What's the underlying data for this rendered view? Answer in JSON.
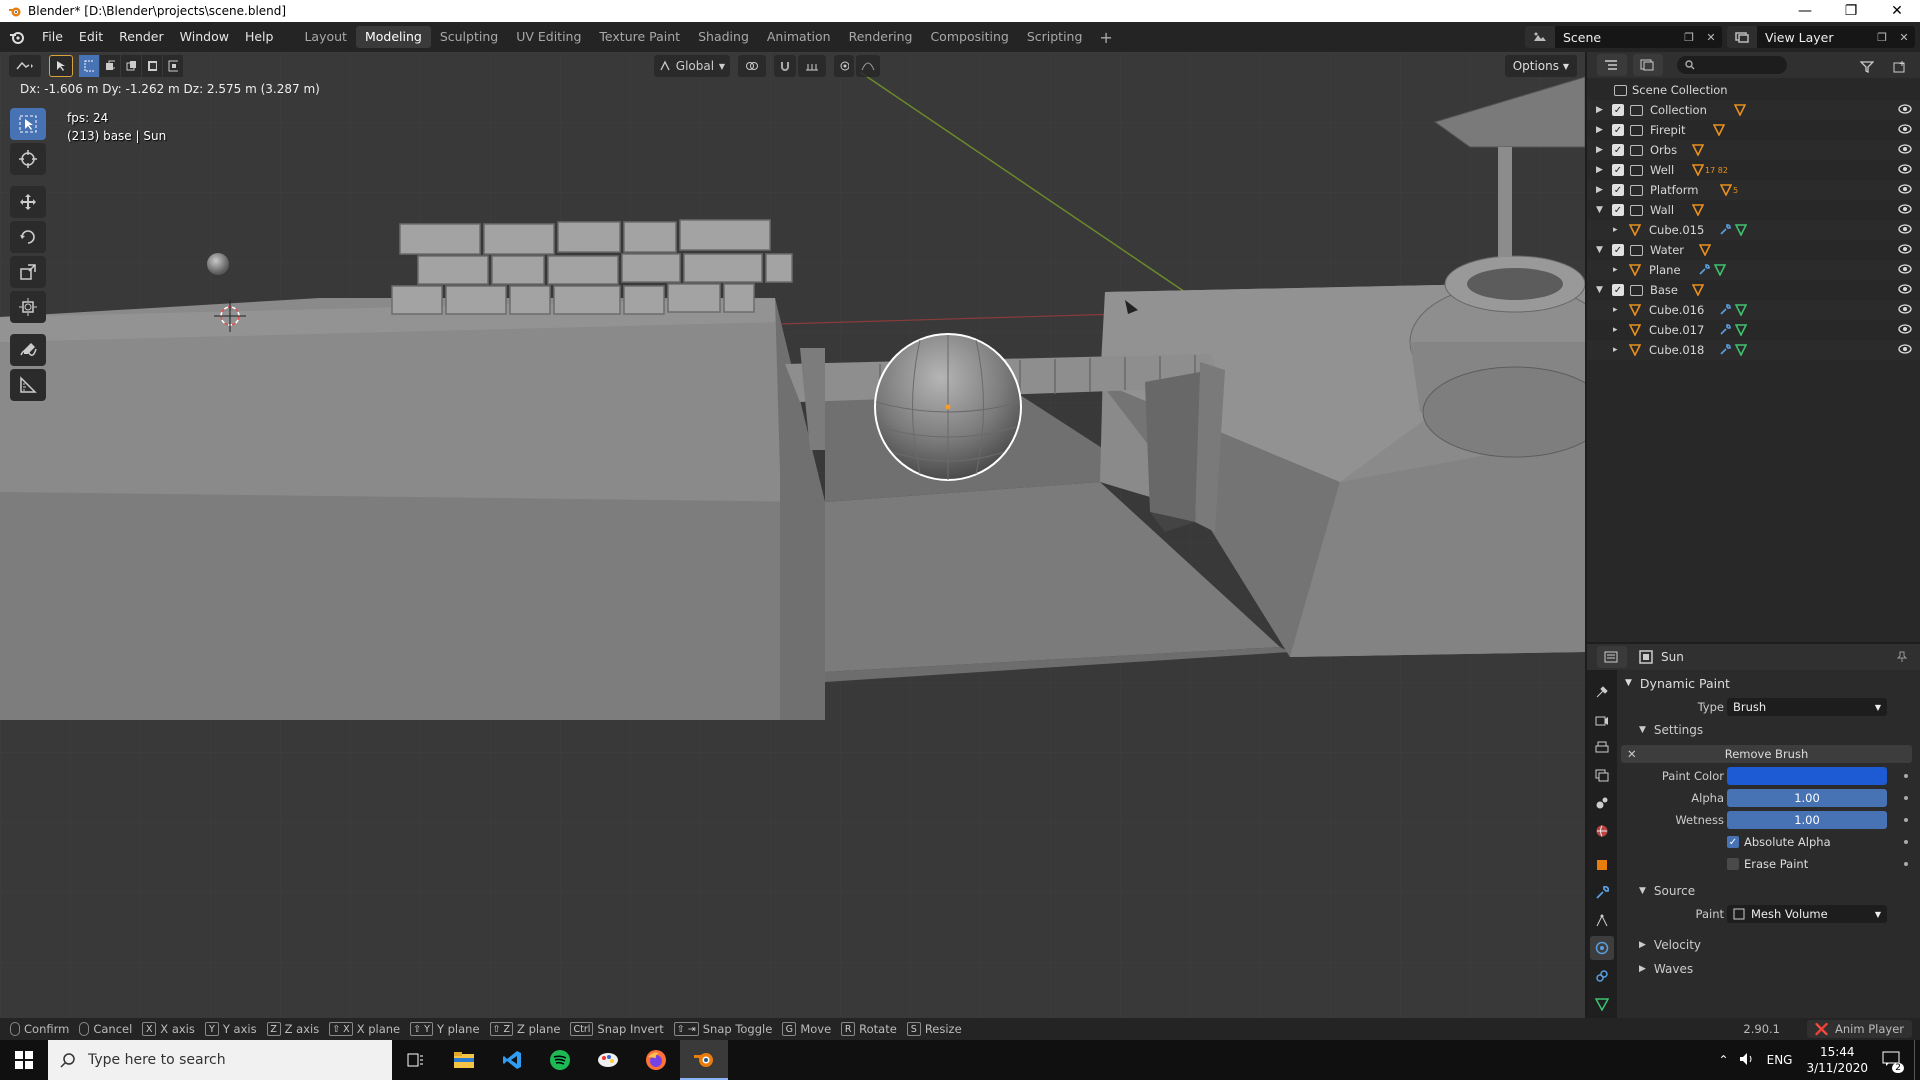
{
  "window": {
    "title": "Blender* [D:\\Blender\\projects\\scene.blend]"
  },
  "menu": [
    "File",
    "Edit",
    "Render",
    "Window",
    "Help"
  ],
  "workspaces": [
    "Layout",
    "Modeling",
    "Sculpting",
    "UV Editing",
    "Texture Paint",
    "Shading",
    "Animation",
    "Rendering",
    "Compositing",
    "Scripting"
  ],
  "active_workspace": "Modeling",
  "scene_name": "Scene",
  "view_layer": "View Layer",
  "viewport": {
    "header": {
      "orientation": "Global",
      "options": "Options"
    },
    "move_info": "Dx: -1.606 m  Dy: -1.262 m  Dz: 2.575 m (3.287 m)",
    "fps": "fps: 24",
    "object_info": "(213) base | Sun"
  },
  "outliner": {
    "root": "Scene Collection",
    "rows": [
      {
        "label": "Collection",
        "kind": "collection",
        "expanded": false,
        "depth": 0
      },
      {
        "label": "Firepit",
        "kind": "collection",
        "expanded": false,
        "depth": 0
      },
      {
        "label": "Orbs",
        "kind": "collection",
        "expanded": false,
        "depth": 0
      },
      {
        "label": "Well",
        "kind": "collection",
        "expanded": false,
        "depth": 0,
        "badge": "17 82"
      },
      {
        "label": "Platform",
        "kind": "collection",
        "expanded": false,
        "depth": 0,
        "badge": "5"
      },
      {
        "label": "Wall",
        "kind": "collection",
        "expanded": true,
        "depth": 0
      },
      {
        "label": "Cube.015",
        "kind": "object",
        "depth": 1
      },
      {
        "label": "Water",
        "kind": "collection",
        "expanded": true,
        "depth": 0
      },
      {
        "label": "Plane",
        "kind": "object",
        "depth": 1
      },
      {
        "label": "Base",
        "kind": "collection",
        "expanded": true,
        "depth": 0
      },
      {
        "label": "Cube.016",
        "kind": "object",
        "depth": 1
      },
      {
        "label": "Cube.017",
        "kind": "object",
        "depth": 1
      },
      {
        "label": "Cube.018",
        "kind": "object",
        "depth": 1
      }
    ]
  },
  "properties": {
    "object": "Sun",
    "panel": "Dynamic Paint",
    "type_label": "Type",
    "type_value": "Brush",
    "settings": "Settings",
    "remove_brush": "Remove Brush",
    "paint_color_label": "Paint Color",
    "paint_color": "#1c5bd4",
    "alpha_label": "Alpha",
    "alpha": "1.00",
    "wetness_label": "Wetness",
    "wetness": "1.00",
    "absolute_alpha": "Absolute Alpha",
    "absolute_alpha_checked": true,
    "erase_paint": "Erase Paint",
    "erase_paint_checked": false,
    "source": "Source",
    "paint_label": "Paint",
    "paint_value": "Mesh Volume",
    "velocity": "Velocity",
    "waves": "Waves"
  },
  "statusbar": {
    "items": [
      {
        "key": "",
        "label": "Confirm"
      },
      {
        "key": "",
        "label": "Cancel"
      },
      {
        "key": "X",
        "label": "X axis"
      },
      {
        "key": "Y",
        "label": "Y axis"
      },
      {
        "key": "Z",
        "label": "Z axis"
      },
      {
        "key": "⇧ X",
        "label": "X plane"
      },
      {
        "key": "⇧ Y",
        "label": "Y plane"
      },
      {
        "key": "⇧ Z",
        "label": "Z plane"
      },
      {
        "key": "Ctrl",
        "label": "Snap Invert"
      },
      {
        "key": "⇧ ⇥",
        "label": "Snap Toggle"
      },
      {
        "key": "G",
        "label": "Move"
      },
      {
        "key": "R",
        "label": "Rotate"
      },
      {
        "key": "S",
        "label": "Resize"
      }
    ],
    "version": "2.90.1",
    "anim_player": "Anim Player"
  },
  "taskbar": {
    "search_placeholder": "Type here to search",
    "lang": "ENG",
    "time": "15:44",
    "date": "3/11/2020",
    "notif_count": "2"
  }
}
